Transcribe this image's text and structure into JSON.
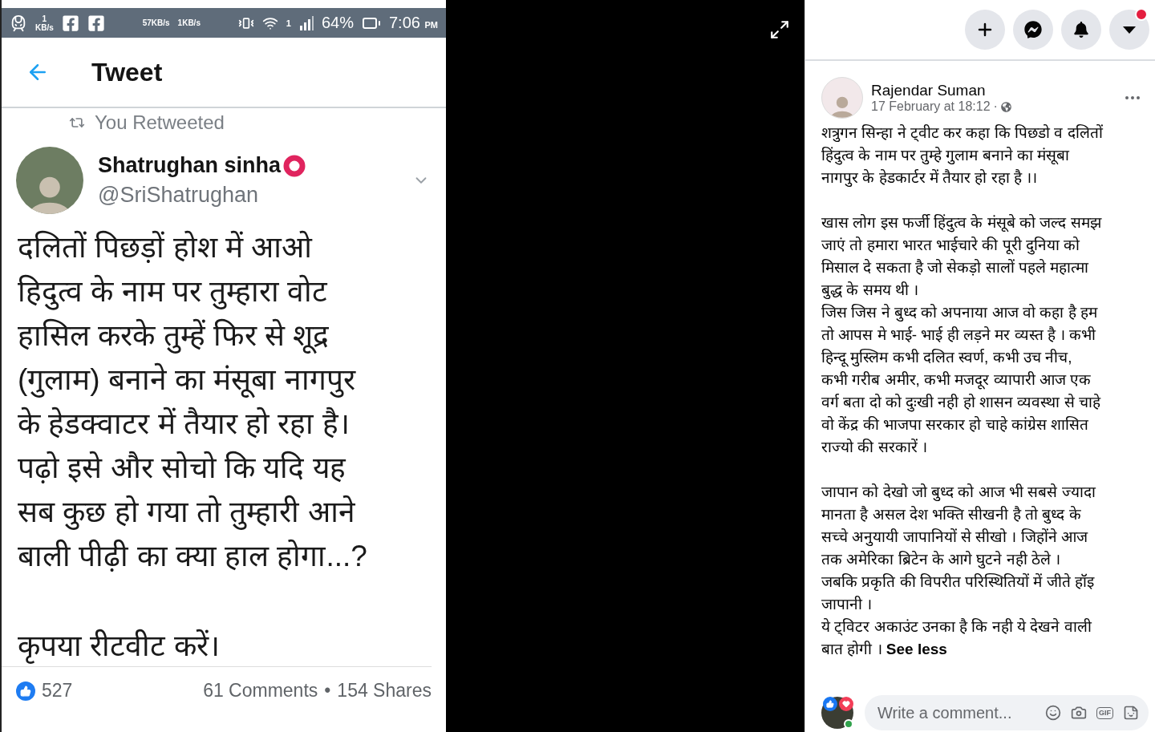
{
  "photo": {
    "status_bar": {
      "net_speed": "1",
      "net_unit": "KB/s",
      "upload": "57KB/s",
      "download": "1KB/s",
      "sim": "1",
      "battery": "64%",
      "time": "7:06",
      "time_suffix": "PM"
    },
    "header": {
      "title": "Tweet"
    },
    "retweet_note": "You Retweeted",
    "author": {
      "name": "Shatrughan sinha",
      "handle": "@SriShatrughan"
    },
    "body": "दलितों पिछड़ों होश में आओ\nहिदुत्व के नाम पर तुम्हारा वोट\nहासिल करके तुम्हें फिर से शूद्र\n(गुलाम) बनाने का मंसूबा नागपुर\nके हेडक्वाटर में तैयार हो रहा है।\nपढ़ो इसे और सोचो कि यदि यह\nसब कुछ हो गया तो तुम्हारी आने\nबाली पीढ़ी का क्या हाल होगा...?",
    "closing": "कृपया रीटवीट करें।",
    "stats": {
      "likes": "527",
      "comments": "61 Comments",
      "separator": "•",
      "shares": "154 Shares"
    }
  },
  "header_buttons": [
    {
      "kind": "create"
    },
    {
      "kind": "messenger"
    },
    {
      "kind": "notifications"
    },
    {
      "kind": "account",
      "badge": true
    }
  ],
  "post": {
    "author": "Rajendar Suman",
    "time": "17 February at 18:12",
    "separator": "·",
    "paragraphs": [
      "शत्रुगन सिन्हा ने ट्वीट कर कहा कि पिछडो व दलितों\nहिंदुत्व के नाम पर तुम्हे गुलाम बनाने का मंसूबा\nनागपुर के हेडकार्टर में तैयार हो रहा है ।।",
      "खास लोग इस फर्जी हिंदुत्व के मंसूबे को जल्द समझ\nजाएं तो हमारा भारत भाईचारे की पूरी दुनिया को\nमिसाल दे सकता है जो सेकड़ो सालों पहले महात्मा\nबुद्ध के समय थी ।\nजिस जिस ने बुध्द को अपनाया आज वो कहा है हम\nतो आपस मे भाई- भाई ही लड़ने मर व्यस्त है । कभी\nहिन्दू मुस्लिम कभी दलित स्वर्ण, कभी उच नीच,\nकभी गरीब अमीर, कभी मजदूर व्यापारी आज एक\nवर्ग बता दो को दुःखी नही हो शासन व्यवस्था से चाहे\nवो केंद्र की भाजपा सरकार हो चाहे कांग्रेस शासित\nराज्यो की सरकारें ।",
      "जापान को देखो जो बुध्द को आज भी सबसे ज्यादा\nमानता है असल देश भक्ति सीखनी है तो बुध्द के\nसच्चे अनुयायी जापानियों से सीखो । जिहोंने आज\nतक अमेरिका ब्रिटेन के आगे घुटने नही ठेले ।\nजबकि प्रकृति की विपरीत परिस्थितियों में जीते हॉइ\nजापानी ।\nये ट्विटर अकाउंट उनका है कि नही ये देखने वाली\nबात होगी ।"
    ],
    "see_less": "See less"
  },
  "comment_box": {
    "placeholder": "Write a comment...",
    "gif_label": "GIF"
  }
}
